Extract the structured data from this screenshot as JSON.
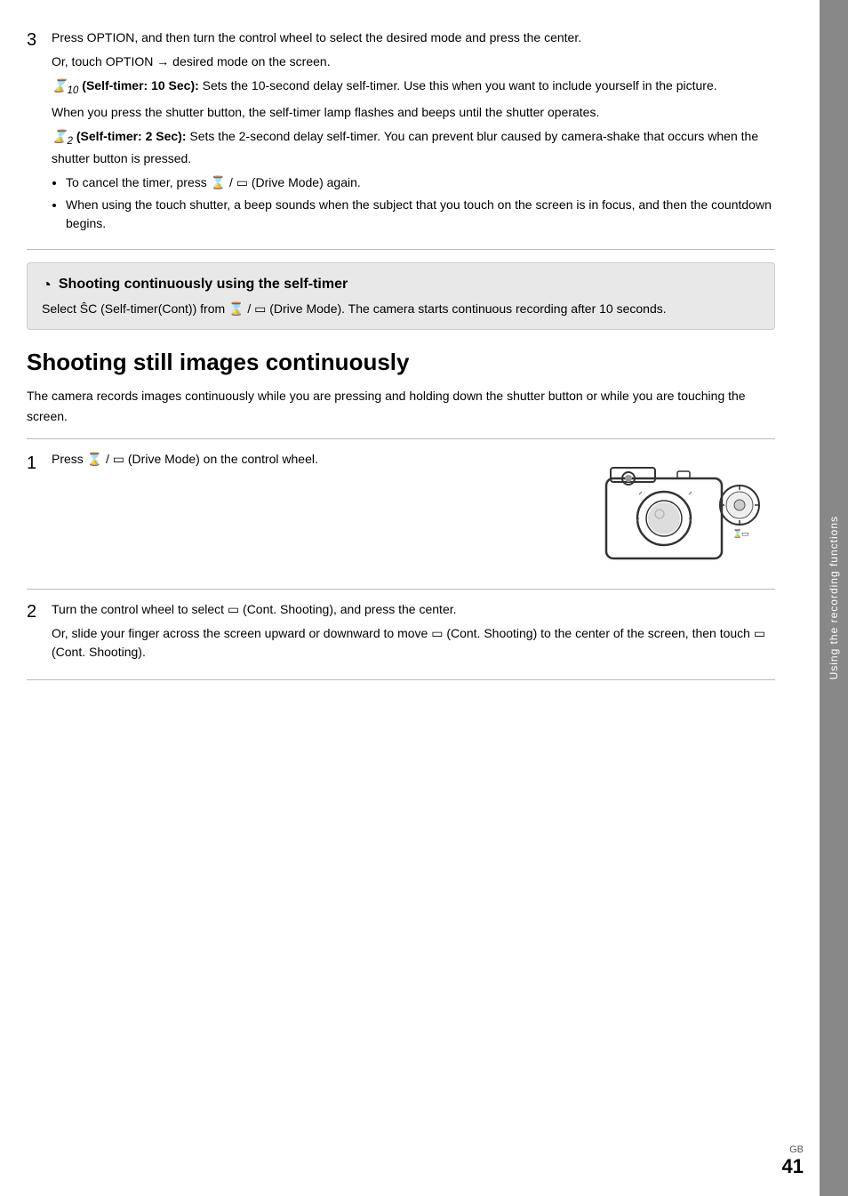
{
  "side_tab": {
    "text": "Using the recording functions"
  },
  "step3": {
    "number": "3",
    "para1": "Press OPTION, and then turn the control wheel to select the desired mode and press the center.",
    "para2": "Or, touch OPTION → desired mode on the screen.",
    "self_timer_10": {
      "label": "𝒮₁₀ (Self-timer: 10 Sec):",
      "desc": "Sets the 10-second delay self-timer. Use this when you want to include yourself in the picture."
    },
    "para3": "When you press the shutter button, the self-timer lamp flashes and beeps until the shutter operates.",
    "self_timer_2": {
      "label": "𝒮₂ (Self-timer: 2 Sec):",
      "desc": "Sets the 2-second delay self-timer. You can prevent blur caused by camera-shake that occurs when the shutter button is pressed."
    },
    "bullets": [
      "To cancel the timer, press 𝒮 / ⊟ (Drive Mode) again.",
      "When using the touch shutter, a beep sounds when the subject that you touch on the screen is in focus, and then the countdown begins."
    ]
  },
  "tip_box": {
    "icon": "⊙",
    "title": "Shooting continuously using the self-timer",
    "body": "Select ℭC (Self-timer(Cont)) from 𝒮 / ⊟ (Drive Mode). The camera starts continuous recording after 10 seconds."
  },
  "section": {
    "heading": "Shooting still images continuously",
    "intro": "The camera records images continuously while you are pressing and holding down the shutter button or while you are touching the screen."
  },
  "step1": {
    "number": "1",
    "text": "Press 𝒮 / ⊟ (Drive Mode) on the control wheel."
  },
  "step2": {
    "number": "2",
    "para1": "Turn the control wheel to select ⊟ (Cont. Shooting), and press the center.",
    "para2": "Or, slide your finger across the screen upward or downward to move ⊟ (Cont. Shooting) to the center of the screen, then touch ⊟ (Cont. Shooting)."
  },
  "page": {
    "gb_label": "GB",
    "number": "41"
  }
}
